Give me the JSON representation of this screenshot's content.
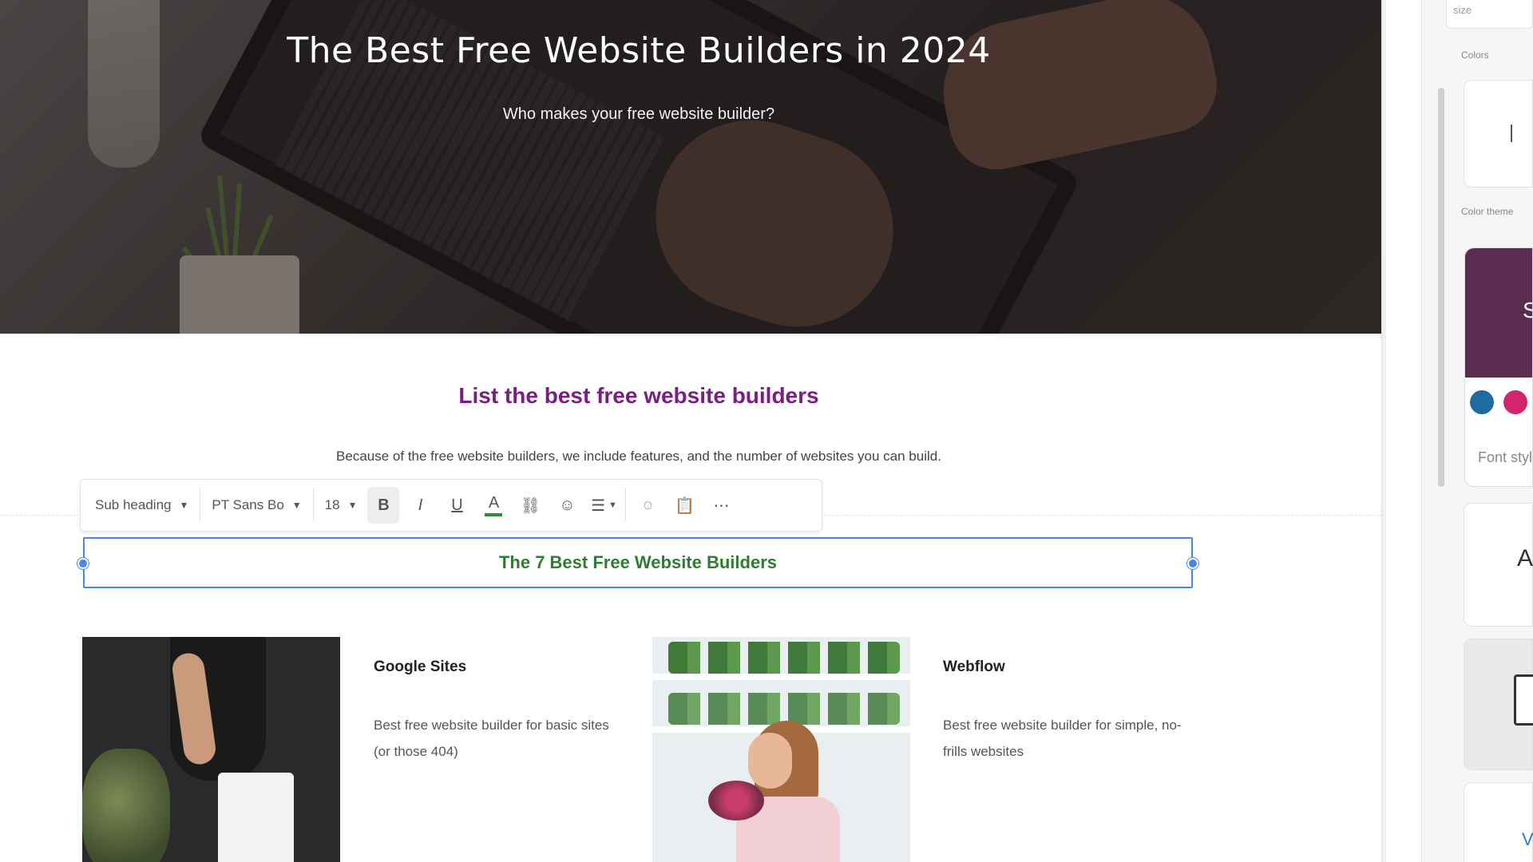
{
  "hero": {
    "title": "The Best Free Website Builders in 2024",
    "subtitle": "Who makes your free website builder?"
  },
  "section": {
    "heading": "List the best free website builders",
    "description": "Because of the free website builders, we include features, and the number of websites you can build."
  },
  "toolbar": {
    "style_select": "Sub heading",
    "font_select": "PT Sans Bo",
    "size_select": "18",
    "bold_label": "B",
    "italic_label": "I",
    "underline_label": "U",
    "text_color_label": "A",
    "link_label": "⛓",
    "emoji_label": "☺",
    "align_label": "☰",
    "comment_label": "◌",
    "clipboard_label": "📋",
    "more_label": "⋯",
    "icons": [
      "bold-icon",
      "italic-icon",
      "underline-icon",
      "text-color-icon",
      "link-icon",
      "emoji-icon",
      "align-icon",
      "comment-icon",
      "clipboard-icon",
      "more-icon"
    ]
  },
  "selected_block": {
    "text": "The 7 Best Free Website Builders"
  },
  "cards": [
    {
      "title": "Google Sites",
      "description": "Best free website builder for basic sites (or those 404)"
    },
    {
      "title": "Webflow",
      "description": "Best free website builder for simple, no-frills websites"
    }
  ],
  "right_panel": {
    "top_label": "size",
    "section_label_1": "Colors",
    "section_label_2": "Color theme",
    "theme_letter": "S",
    "font_label": "Font style",
    "card_letter": "A",
    "bottom_letter": "V",
    "colors": {
      "theme": "#5a2c50",
      "blue": "#1f6a9e",
      "pink": "#d4246e"
    }
  },
  "colors": {
    "heading_purple": "#7a1e86",
    "selected_text_green": "#2f7d32",
    "selection_blue": "#4a86e8"
  }
}
